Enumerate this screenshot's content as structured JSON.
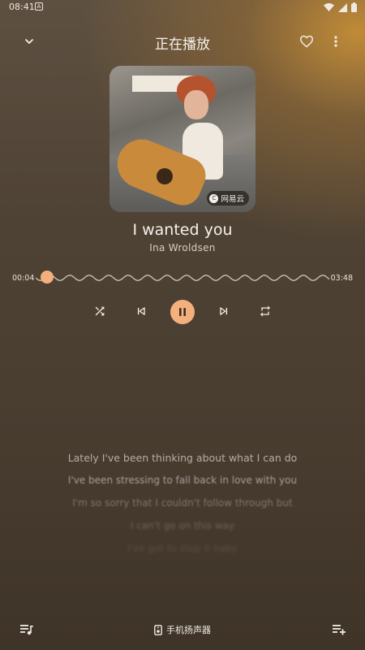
{
  "status_bar": {
    "time": "08:41",
    "notification_glyph": "A"
  },
  "header": {
    "title": "正在播放"
  },
  "album": {
    "badge_text": "网易云",
    "badge_logo": "C"
  },
  "track": {
    "title": "I wanted you",
    "artist": "Ina Wroldsen"
  },
  "progress": {
    "elapsed": "00:04",
    "duration": "03:48",
    "fraction": 0.018
  },
  "lyrics": [
    "Lately I've been thinking about what I can do",
    "I've been stressing to fall back in love with you",
    "I'm so sorry that I couldn't follow through but",
    "I can't go on this way",
    "I've got to stop it baby"
  ],
  "footer": {
    "output_device": "手机扬声器"
  },
  "colors": {
    "accent": "#f3b07c"
  },
  "icons": {
    "collapse": "chevron-down-icon",
    "favorite": "heart-icon",
    "more": "more-vertical-icon",
    "shuffle": "shuffle-icon",
    "previous": "skip-previous-icon",
    "pause": "pause-icon",
    "next": "skip-next-icon",
    "repeat": "repeat-icon",
    "playlist": "playlist-icon",
    "speaker": "speaker-icon",
    "add_to_playlist": "playlist-add-icon"
  }
}
